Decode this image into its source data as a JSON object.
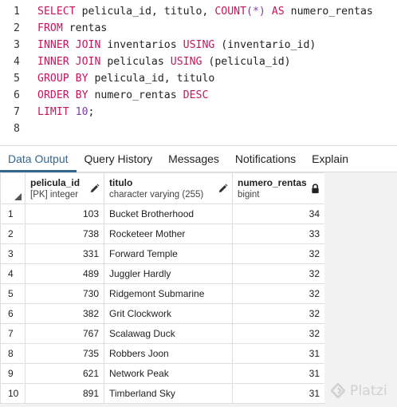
{
  "editor": {
    "line_numbers": [
      "1",
      "2",
      "3",
      "4",
      "5",
      "6",
      "7",
      "8"
    ]
  },
  "tabs": [
    {
      "label": "Data Output",
      "active": true
    },
    {
      "label": "Query History",
      "active": false
    },
    {
      "label": "Messages",
      "active": false
    },
    {
      "label": "Notifications",
      "active": false
    },
    {
      "label": "Explain",
      "active": false
    }
  ],
  "grid": {
    "columns": [
      {
        "name": "pelicula_id",
        "type": "[PK] integer",
        "icon": "pencil-icon"
      },
      {
        "name": "titulo",
        "type": "character varying (255)",
        "icon": "pencil-icon"
      },
      {
        "name": "numero_rentas",
        "type": "bigint",
        "icon": "lock-icon"
      }
    ],
    "rows": [
      {
        "n": "1",
        "pelicula_id": "103",
        "titulo": "Bucket Brotherhood",
        "numero_rentas": "34"
      },
      {
        "n": "2",
        "pelicula_id": "738",
        "titulo": "Rocketeer Mother",
        "numero_rentas": "33"
      },
      {
        "n": "3",
        "pelicula_id": "331",
        "titulo": "Forward Temple",
        "numero_rentas": "32"
      },
      {
        "n": "4",
        "pelicula_id": "489",
        "titulo": "Juggler Hardly",
        "numero_rentas": "32"
      },
      {
        "n": "5",
        "pelicula_id": "730",
        "titulo": "Ridgemont Submarine",
        "numero_rentas": "32"
      },
      {
        "n": "6",
        "pelicula_id": "382",
        "titulo": "Grit Clockwork",
        "numero_rentas": "32"
      },
      {
        "n": "7",
        "pelicula_id": "767",
        "titulo": "Scalawag Duck",
        "numero_rentas": "32"
      },
      {
        "n": "8",
        "pelicula_id": "735",
        "titulo": "Robbers Joon",
        "numero_rentas": "31"
      },
      {
        "n": "9",
        "pelicula_id": "621",
        "titulo": "Network Peak",
        "numero_rentas": "31"
      },
      {
        "n": "10",
        "pelicula_id": "891",
        "titulo": "Timberland Sky",
        "numero_rentas": "31"
      }
    ]
  },
  "watermark": {
    "text": "Platzi"
  },
  "colors": {
    "keyword": "#c6155c",
    "number": "#7a3e9d",
    "active_tab": "#326690"
  }
}
